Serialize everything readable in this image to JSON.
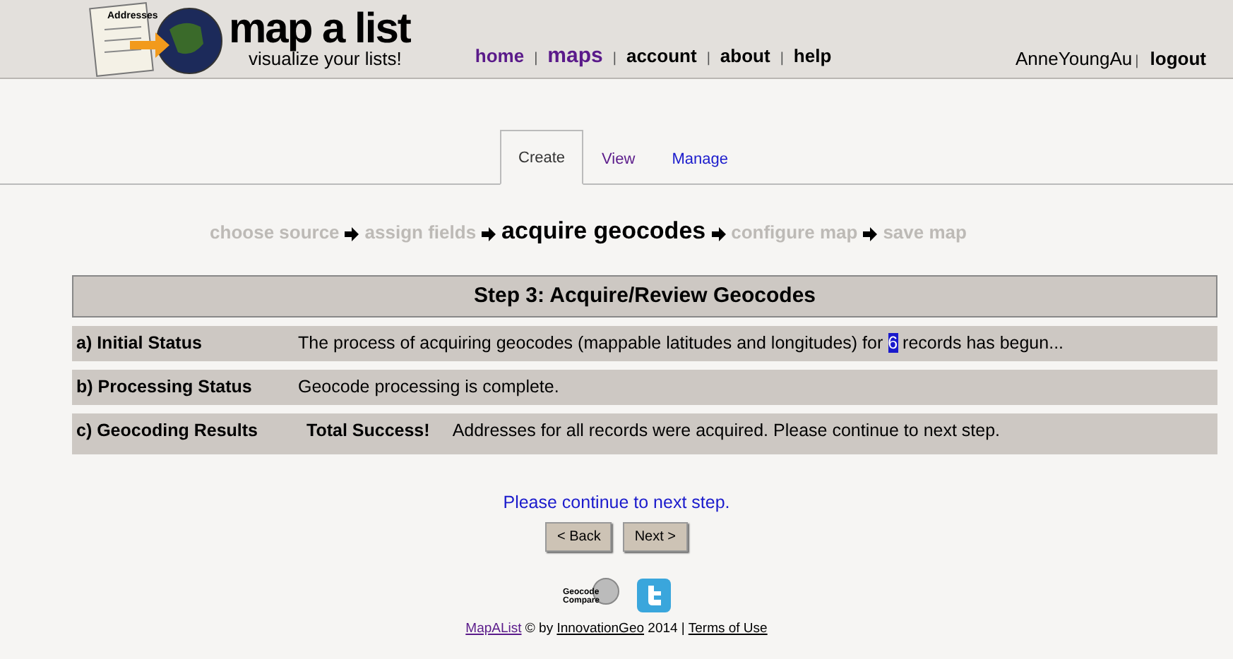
{
  "logo": {
    "paper_label": "Addresses",
    "title": "map a list",
    "tagline": "visualize your lists!"
  },
  "nav": [
    {
      "label": "home",
      "selected": false,
      "visited": true
    },
    {
      "label": "maps",
      "selected": true,
      "visited": true
    },
    {
      "label": "account",
      "selected": false,
      "visited": false
    },
    {
      "label": "about",
      "selected": false,
      "visited": false
    },
    {
      "label": "help",
      "selected": false,
      "visited": false
    }
  ],
  "nav_separators": [
    "|",
    "|",
    "|",
    "|"
  ],
  "user": {
    "name": "AnneYoungAu",
    "separator": "|",
    "logout": "logout"
  },
  "tabs": [
    {
      "label": "Create",
      "selected": true,
      "visited": false
    },
    {
      "label": "View",
      "selected": false,
      "visited": true
    },
    {
      "label": "Manage",
      "selected": false,
      "visited": false
    }
  ],
  "steps": [
    {
      "label": "choose source",
      "selected": false
    },
    {
      "label": "assign fields",
      "selected": false
    },
    {
      "label": "acquire geocodes",
      "selected": true
    },
    {
      "label": "configure map",
      "selected": false
    },
    {
      "label": "save map",
      "selected": false
    }
  ],
  "panel": {
    "title": "Step 3: Acquire/Review Geocodes",
    "rows": [
      {
        "label": "a) Initial Status",
        "kind": "count",
        "before": "The process of acquiring geocodes (mappable latitudes and longitudes) for",
        "count": "6",
        "after": "records has begun..."
      },
      {
        "label": "b) Processing Status",
        "kind": "plain",
        "text": "Geocode processing is complete."
      },
      {
        "label": "c) Geocoding Results",
        "kind": "result",
        "strong": "Total Success!",
        "text": "Addresses for all records were acquired. Please continue to next step."
      }
    ]
  },
  "message": "Please continue to next step.",
  "buttons": [
    "< Back",
    "Next >"
  ],
  "badge_text": "Geocode Compare",
  "footer": {
    "site": "MapAList",
    "by": "© by",
    "company": "InnovationGeo",
    "year": "2014 |",
    "terms": "Terms of Use"
  }
}
